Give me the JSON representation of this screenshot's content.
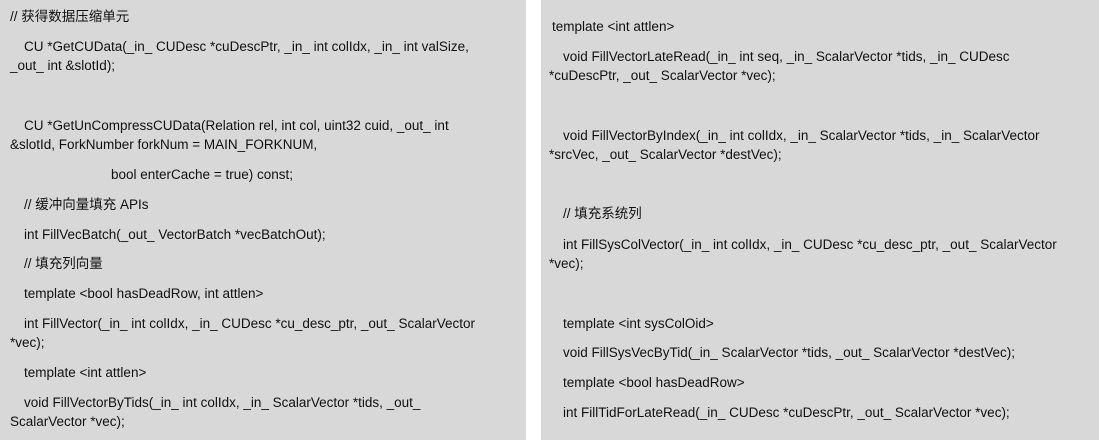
{
  "left_panel": {
    "lines": [
      "// 获得数据压缩单元",
      "CU *GetCUData(_in_ CUDesc *cuDescPtr, _in_ int colIdx, _in_ int valSize,",
      "_out_ int &slotId);",
      "CU *GetUnCompressCUData(Relation rel, int col, uint32 cuid, _out_ int",
      "&slotId, ForkNumber  forkNum = MAIN_FORKNUM,",
      "bool enterCache = true) const;",
      "// 缓冲向量填充 APIs",
      "int FillVecBatch(_out_ VectorBatch *vecBatchOut);",
      "// 填充列向量",
      "template <bool hasDeadRow, int attlen>",
      "int FillVector(_in_ int colIdx, _in_ CUDesc *cu_desc_ptr, _out_ ScalarVector",
      "*vec);",
      "template <int attlen>",
      "void FillVectorByTids(_in_ int colIdx, _in_ ScalarVector *tids, _out_",
      "ScalarVector *vec);"
    ]
  },
  "right_panel": {
    "lines": [
      "template <int attlen>",
      "void FillVectorLateRead(_in_ int seq, _in_ ScalarVector *tids, _in_ CUDesc",
      "*cuDescPtr, _out_ ScalarVector *vec);",
      "void FillVectorByIndex(_in_ int colIdx, _in_ ScalarVector *tids, _in_ ScalarVector",
      "*srcVec, _out_ ScalarVector *destVec);",
      "// 填充系统列",
      "int FillSysColVector(_in_ int colIdx, _in_ CUDesc *cu_desc_ptr, _out_ ScalarVector",
      "*vec);",
      "template <int sysColOid>",
      "void FillSysVecByTid(_in_ ScalarVector *tids, _out_ ScalarVector *destVec);",
      "template <bool hasDeadRow>",
      "int FillTidForLateRead(_in_ CUDesc *cuDescPtr, _out_ ScalarVector *vec);"
    ]
  }
}
